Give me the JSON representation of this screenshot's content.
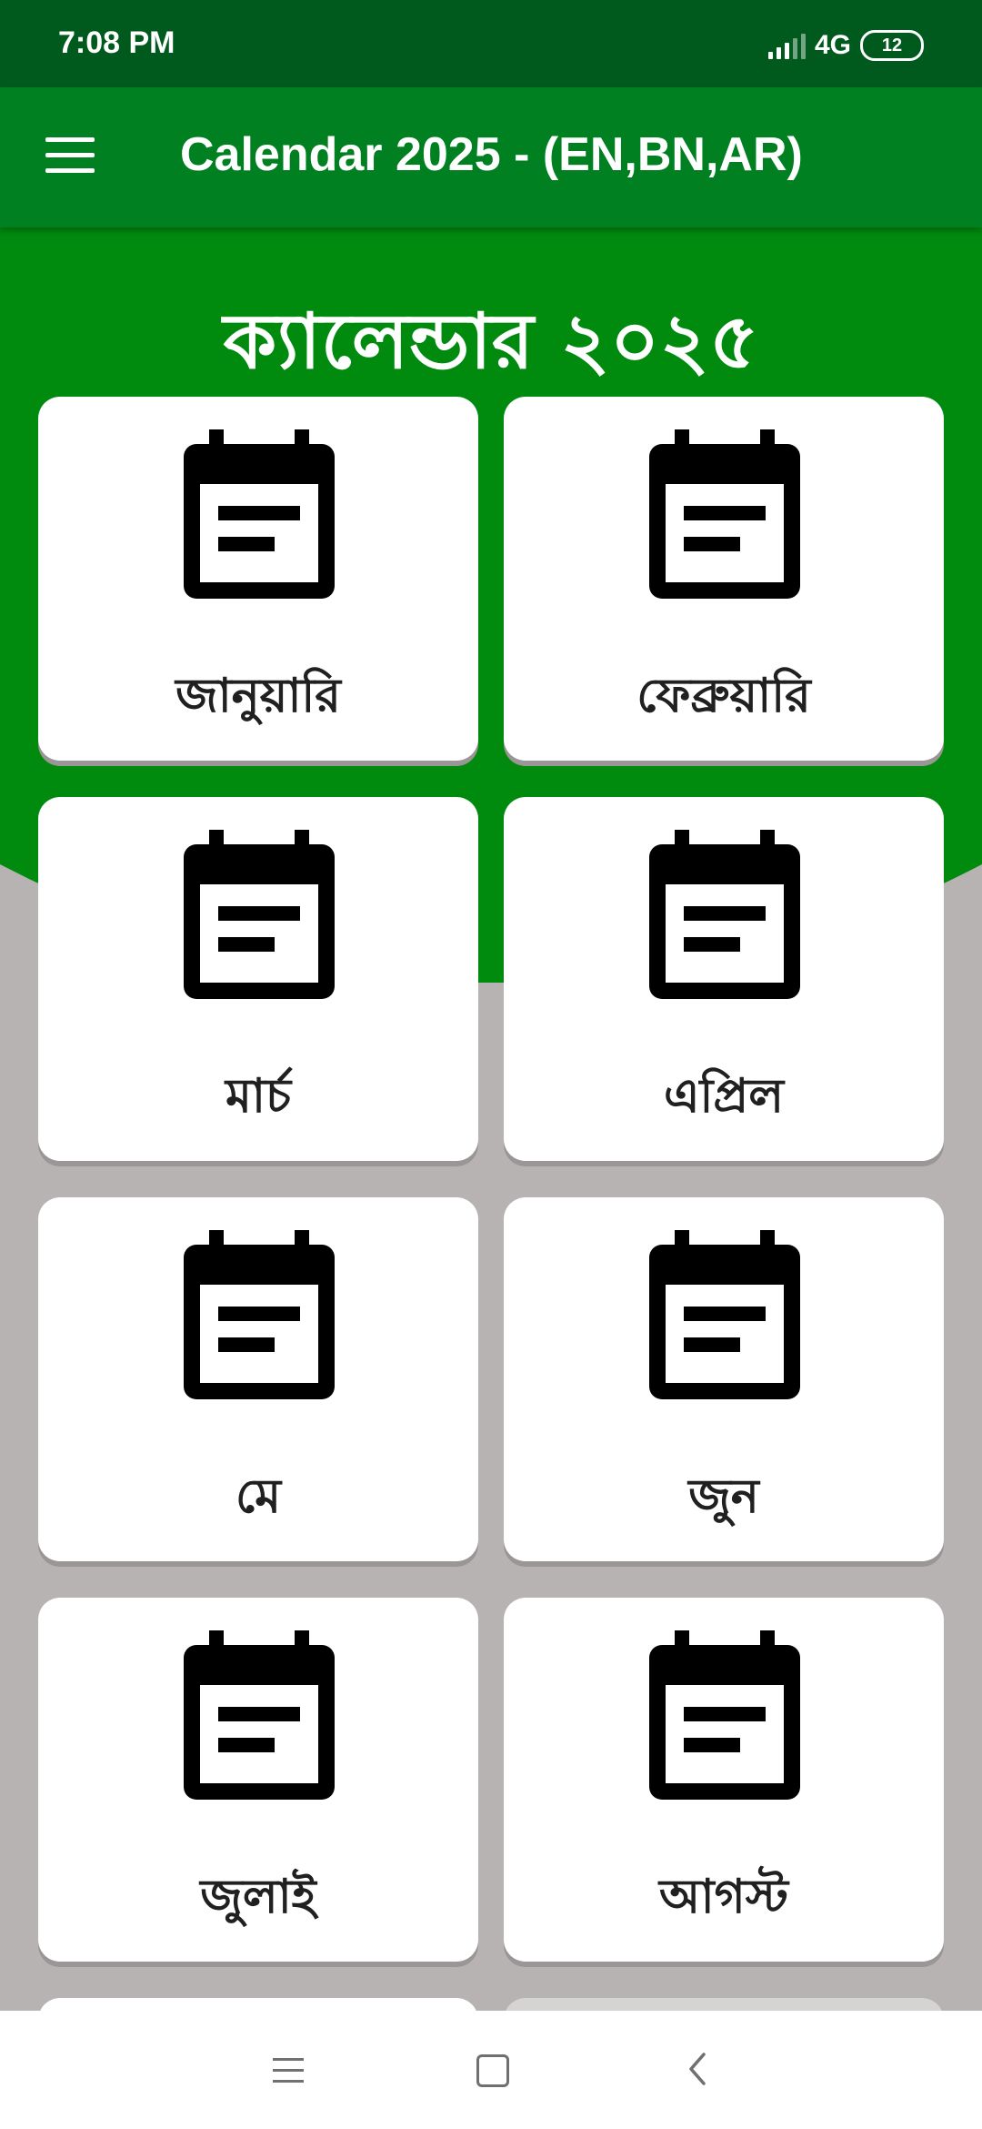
{
  "status_bar": {
    "time": "7:08 PM",
    "network": "4G",
    "battery": "12"
  },
  "app_bar": {
    "title": "Calendar 2025 - (EN,BN,AR)",
    "menu_icon": "hamburger-menu-icon"
  },
  "hero": {
    "title": "ক্যালেন্ডার ২০২৫"
  },
  "months": [
    {
      "label": "জানুয়ারি",
      "icon": "calendar-icon"
    },
    {
      "label": "ফেব্রুয়ারি",
      "icon": "calendar-icon"
    },
    {
      "label": "মার্চ",
      "icon": "calendar-icon"
    },
    {
      "label": "এপ্রিল",
      "icon": "calendar-icon"
    },
    {
      "label": "মে",
      "icon": "calendar-icon"
    },
    {
      "label": "জুন",
      "icon": "calendar-icon"
    },
    {
      "label": "জুলাই",
      "icon": "calendar-icon"
    },
    {
      "label": "আগস্ট",
      "icon": "calendar-icon"
    }
  ],
  "nav_bar": {
    "icons": [
      "recents-icon",
      "home-icon",
      "back-icon"
    ]
  },
  "colors": {
    "status_bar": "#005a1e",
    "app_bar": "#008020",
    "hero": "#008a0e",
    "background": "#b8b3b3",
    "card": "#ffffff"
  }
}
